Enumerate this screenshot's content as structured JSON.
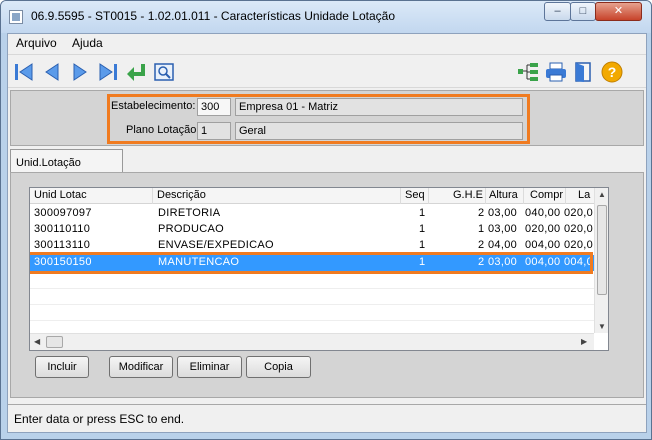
{
  "window": {
    "title": "06.9.5595 - ST0015 - 1.02.01.011 - Características Unidade Lotação",
    "min_glyph": "–",
    "max_glyph": "□",
    "close_glyph": "✕"
  },
  "menu": {
    "file": "Arquivo",
    "help": "Ajuda"
  },
  "toolbar": {
    "left_icons": [
      "first-record-icon",
      "previous-record-icon",
      "next-record-icon",
      "last-record-icon",
      "return-icon",
      "search-icon"
    ],
    "right_icons": [
      "structure-icon",
      "print-icon",
      "exit-icon",
      "help-icon"
    ],
    "help_glyph": "?"
  },
  "header": {
    "estab_label": "Estabelecimento:",
    "estab_code": "300",
    "estab_name": "Empresa 01 - Matriz",
    "plano_label": "Plano Lotação:",
    "plano_code": "1",
    "plano_name": "Geral"
  },
  "tab": {
    "label": "Unid.Lotação"
  },
  "grid": {
    "columns": [
      "Unid Lotac",
      "Descrição",
      "Seq",
      "G.H.E",
      "Altura",
      "Compr",
      "La"
    ],
    "rows": [
      [
        "300097097",
        "DIRETORIA",
        "1",
        "2",
        "03,00",
        "040,00",
        "020,0"
      ],
      [
        "300110110",
        "PRODUCAO",
        "1",
        "1",
        "03,00",
        "020,00",
        "020,0"
      ],
      [
        "300113110",
        "ENVASE/EXPEDICAO",
        "1",
        "2",
        "04,00",
        "004,00",
        "020,0"
      ],
      [
        "300150150",
        "MANUTENCAO",
        "1",
        "2",
        "03,00",
        "004,00",
        "004,0"
      ]
    ],
    "selected_row": 3
  },
  "buttons": {
    "add": "Incluir",
    "modify": "Modificar",
    "delete": "Eliminar",
    "copy": "Copia"
  },
  "status": {
    "text": "Enter data or press ESC to end."
  },
  "colors": {
    "highlight": "#f07b20",
    "selection": "#3399ff"
  }
}
